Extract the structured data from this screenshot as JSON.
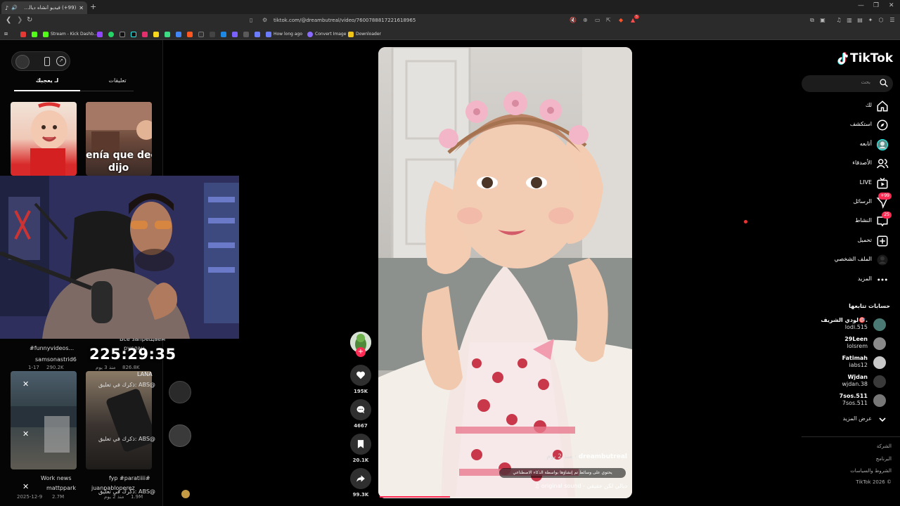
{
  "browser": {
    "tab_title": "(99+) فيديو أنشأه ديالي لكن ح...",
    "url": "tiktok.com/@dreambutreal/video/7600788817221618965",
    "bookmarks": [
      {
        "label": "Stream - Kick Dashb...",
        "color": "#53fc18"
      },
      {
        "label": "How long ago",
        "color": "#6b7cff"
      },
      {
        "label": "Convert Image",
        "color": "#8a6bff"
      },
      {
        "label": "Downloader",
        "color": "#f0c419"
      }
    ],
    "notification_count": "5"
  },
  "left_panel": {
    "tabs": {
      "for_you": "لـ يعجبك",
      "comments": "تعليقات"
    },
    "thumb2_caption_1": "enía que decir",
    "thumb2_caption_2": "dijo",
    "grid": {
      "item1_title": "#funnyvideos...",
      "item1_user": "samsonastrid6",
      "item1_date": "1-17",
      "item1_views": "290.2K",
      "item2_title": "Все запрещаем",
      "item2_user": "руслан",
      "item2_date": "منذ 3 يوم",
      "item2_views": "826.8K",
      "mention1": "ذكرك في تعليق: ABS@",
      "mention2": "ذكرك في تعليق: ABS@",
      "mention3": "ذكرك في تعليق: ABS@",
      "item3_title": "Work news",
      "item3_user": "mattppark",
      "item3_date": "2025-12-9",
      "item3_views": "2.7M",
      "item4_title": "fyp #paratiiii#",
      "item4_user": "juanpabloperez",
      "item4_date": "منذ 2 يوم",
      "item4_views": "1.9M"
    },
    "lana": "LANA",
    "timer": "225:29:35"
  },
  "video": {
    "creator": "dreambutreal",
    "time_ago": "منذ 2 يوم",
    "ai_notice": "يحتوي على وسائط تم إنشاؤها بواسطة الذكاء الاصطناعي",
    "sound": "original sound - ديالي لكن حقيقي",
    "likes": "195K",
    "comments": "4667",
    "saves": "20.1K",
    "shares": "99.3K",
    "progress": 0.28
  },
  "sidebar": {
    "logo": "TikTok",
    "search_placeholder": "بحث",
    "nav": [
      {
        "label": "لك",
        "icon": "home-icon"
      },
      {
        "label": "استكشف",
        "icon": "compass-icon"
      },
      {
        "label": "أتابعه",
        "icon": "following-icon"
      },
      {
        "label": "الأصدقاء",
        "icon": "friends-icon"
      },
      {
        "label": "LIVE",
        "icon": "live-icon"
      },
      {
        "label": "الرسائل",
        "icon": "messages-icon",
        "badge": "+99"
      },
      {
        "label": "النشاط",
        "icon": "activity-icon",
        "badge": "25"
      },
      {
        "label": "تحميل",
        "icon": "upload-icon"
      },
      {
        "label": "الملف الشخصي",
        "icon": "profile-icon"
      },
      {
        "label": "المزيد",
        "icon": "more-icon"
      }
    ],
    "following_title": "حسابات تتابعها",
    "accounts": [
      {
        "name": "لودي الشريف🎯.",
        "handle": "lodi.515",
        "color": "#4a7a73"
      },
      {
        "name": "29Leen",
        "handle": "lolsrem",
        "color": "#8a8a8a"
      },
      {
        "name": "Fatimah",
        "handle": "iabs12",
        "color": "#c8c8c8"
      },
      {
        "name": "Wjdan",
        "handle": "wjdan.38",
        "color": "#3a3a3a"
      },
      {
        "name": "7sos.511",
        "handle": "7sos.511",
        "color": "#777"
      }
    ],
    "show_more": "عرض المزيد",
    "footer": [
      "الشركة",
      "البرنامج",
      "الشروط والسياسات",
      "© 2026 TikTok"
    ]
  }
}
